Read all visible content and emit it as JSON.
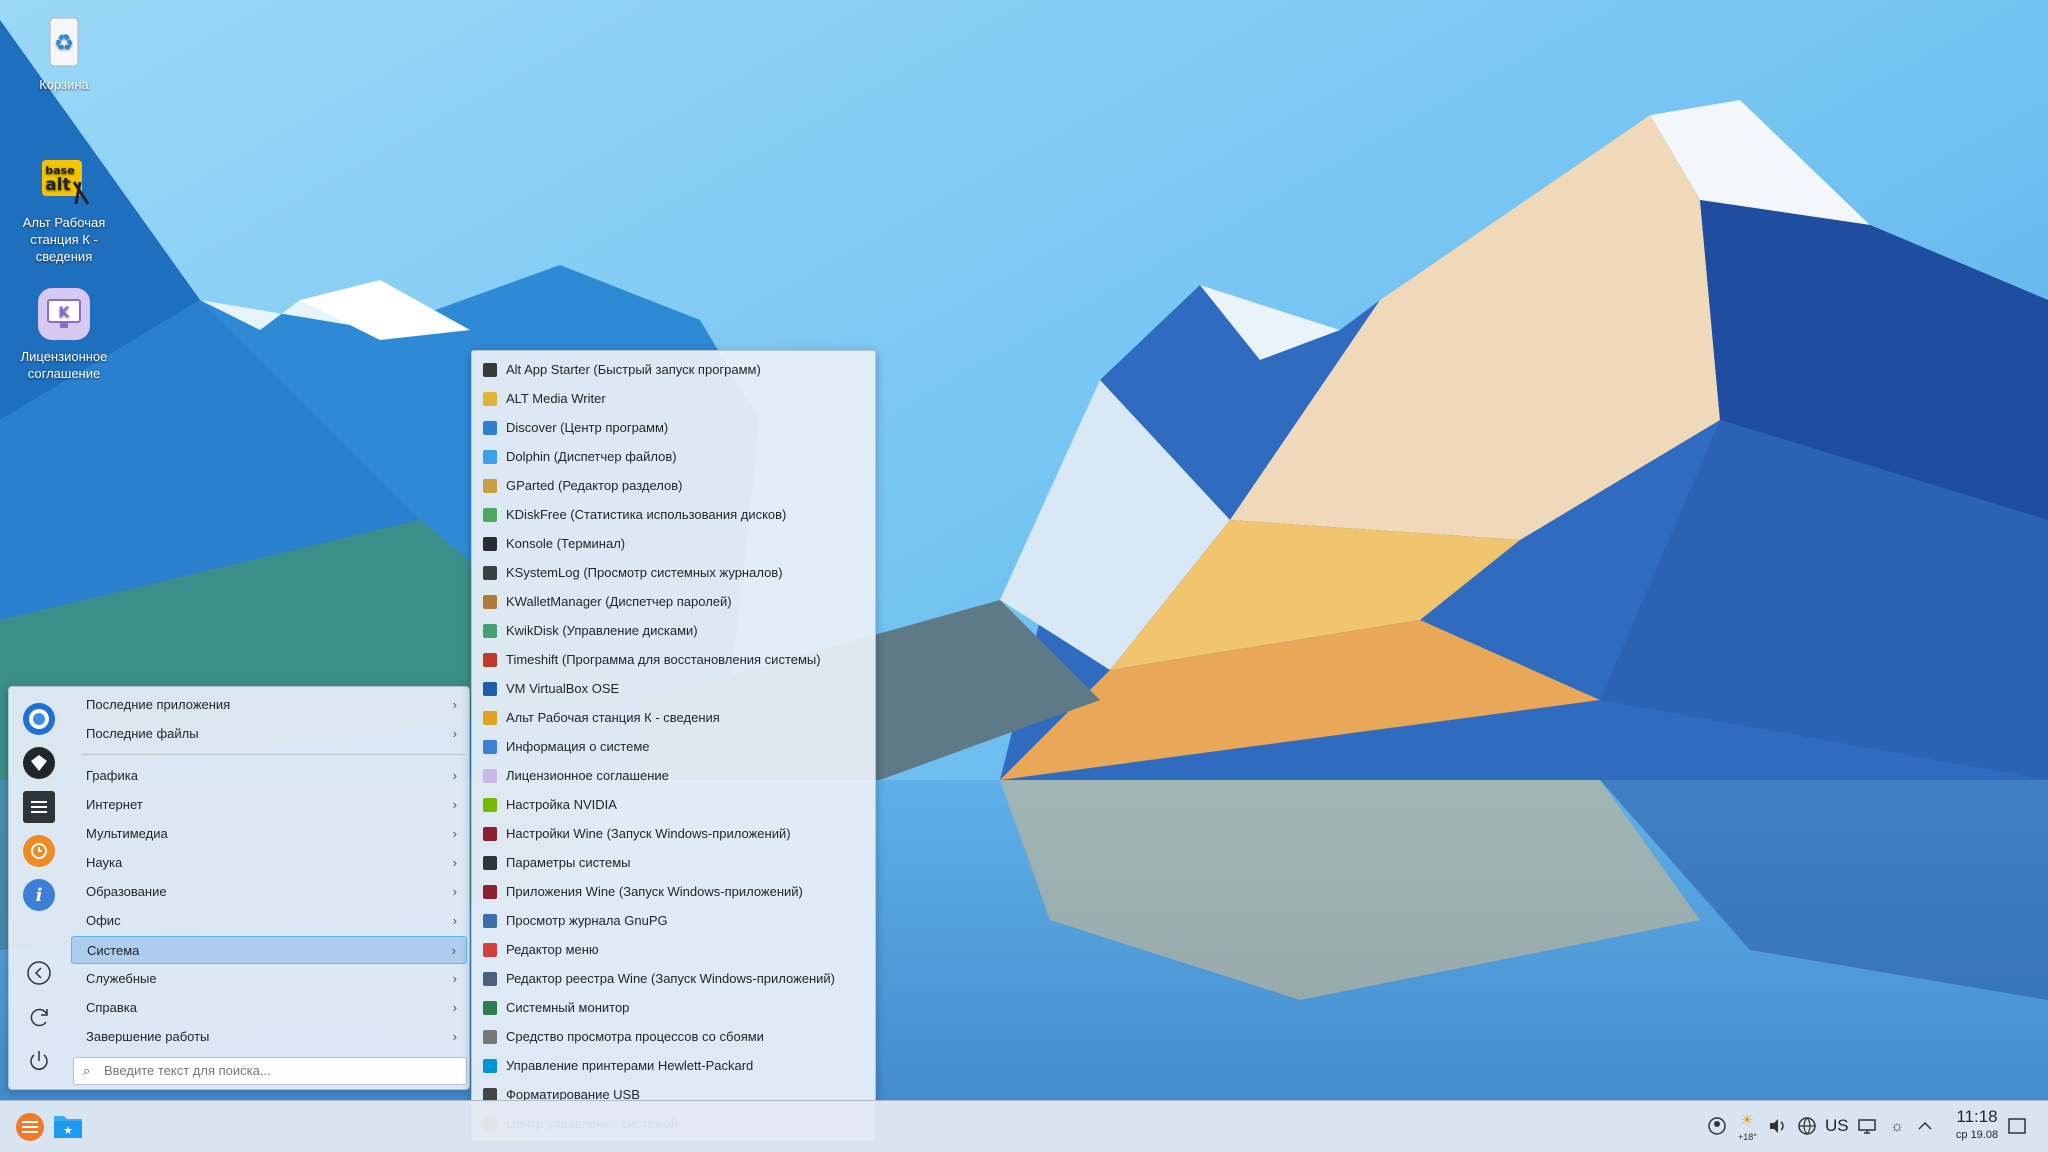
{
  "desktop": {
    "icons": [
      {
        "label": "Корзина"
      },
      {
        "label": "Альт Рабочая станция К - сведения"
      },
      {
        "label": "Лицензионное соглашение"
      }
    ],
    "alt_logo_text": "base alt"
  },
  "menu": {
    "categories": [
      {
        "label": "Последние приложения"
      },
      {
        "label": "Последние файлы"
      },
      {
        "label": "Графика"
      },
      {
        "label": "Интернет"
      },
      {
        "label": "Мультимедиа"
      },
      {
        "label": "Наука"
      },
      {
        "label": "Образование"
      },
      {
        "label": "Офис"
      },
      {
        "label": "Система"
      },
      {
        "label": "Служебные"
      },
      {
        "label": "Справка"
      },
      {
        "label": "Завершение работы"
      }
    ],
    "selected_category": "Система",
    "search_placeholder": "Введите текст для поиска...",
    "favorites": [
      "chromium-icon",
      "kwallet-icon",
      "system-settings-icon",
      "timeshift-icon",
      "info-icon"
    ],
    "actions": [
      "back-icon",
      "refresh-icon",
      "power-icon"
    ]
  },
  "submenu": {
    "items": [
      {
        "label": "Alt App Starter (Быстрый запуск программ)",
        "color": "#3a3a3a"
      },
      {
        "label": "ALT Media Writer",
        "color": "#e0b43a"
      },
      {
        "label": "Discover (Центр программ)",
        "color": "#2f7fd0"
      },
      {
        "label": "Dolphin (Диспетчер файлов)",
        "color": "#3da0e6"
      },
      {
        "label": "GParted (Редактор разделов)",
        "color": "#c8a040"
      },
      {
        "label": "KDiskFree (Статистика использования дисков)",
        "color": "#4aa860"
      },
      {
        "label": "Konsole (Терминал)",
        "color": "#2a2e32"
      },
      {
        "label": "KSystemLog (Просмотр системных журналов)",
        "color": "#3a3f44"
      },
      {
        "label": "KWalletManager (Диспетчер паролей)",
        "color": "#b07a3a"
      },
      {
        "label": "KwikDisk (Управление дисками)",
        "color": "#48a070"
      },
      {
        "label": "Timeshift (Программа для восстановления системы)",
        "color": "#c0392b"
      },
      {
        "label": "VM VirtualBox OSE",
        "color": "#1f5fa8"
      },
      {
        "label": "Альт Рабочая станция К - сведения",
        "color": "#e0a020"
      },
      {
        "label": "Информация о системе",
        "color": "#3d7fd6"
      },
      {
        "label": "Лицензионное соглашение",
        "color": "#c9b8e6"
      },
      {
        "label": "Настройка NVIDIA",
        "color": "#76b900"
      },
      {
        "label": "Настройки Wine (Запуск Windows-приложений)",
        "color": "#8a2030"
      },
      {
        "label": "Параметры системы",
        "color": "#2f3439"
      },
      {
        "label": "Приложения Wine (Запуск Windows-приложений)",
        "color": "#8a2030"
      },
      {
        "label": "Просмотр журнала GnuPG",
        "color": "#3a6fa8"
      },
      {
        "label": "Редактор меню",
        "color": "#d04040"
      },
      {
        "label": "Редактор реестра Wine (Запуск Windows-приложений)",
        "color": "#4a6080"
      },
      {
        "label": "Системный монитор",
        "color": "#2e7d4f"
      },
      {
        "label": "Средство просмотра процессов со сбоями",
        "color": "#777777"
      },
      {
        "label": "Управление принтерами Hewlett-Packard",
        "color": "#0096d6"
      },
      {
        "label": "Форматирование USB",
        "color": "#444444"
      },
      {
        "label": "Центр управления системой",
        "color": "#e07020"
      }
    ]
  },
  "panel": {
    "keyboard_layout": "US",
    "weather_temp": "+18°",
    "clock_time": "11:18",
    "clock_date": "ср 19.08"
  }
}
